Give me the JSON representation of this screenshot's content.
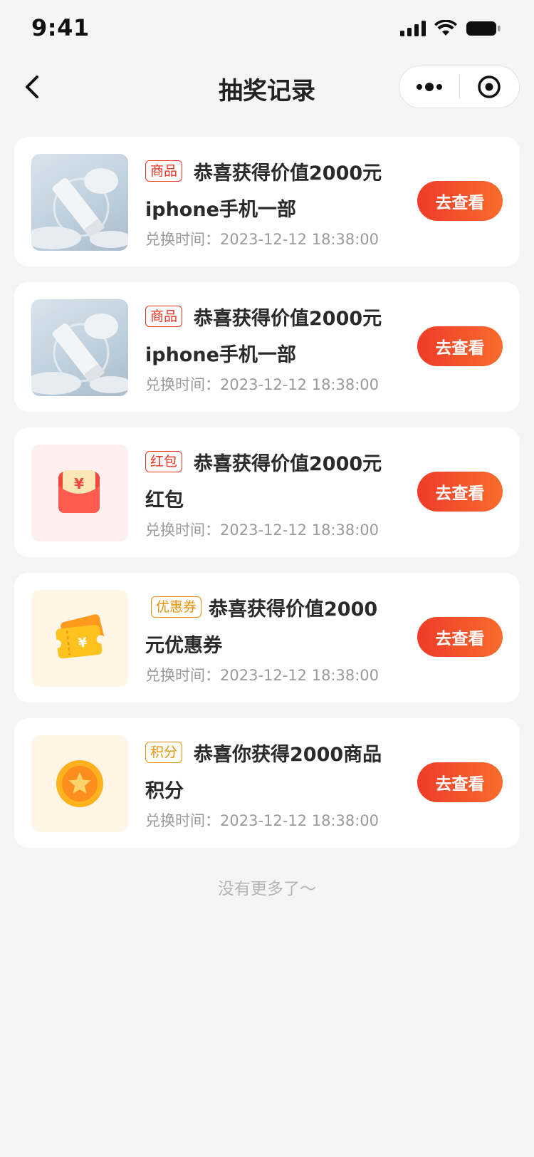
{
  "status_bar": {
    "time": "9:41"
  },
  "nav": {
    "title": "抽奖记录"
  },
  "records": [
    {
      "tag": "商品",
      "tag_color": "#e93323",
      "title_line1": "恭喜获得价值2000元",
      "title_line2": "iphone手机一部",
      "time_label": "兑换时间：",
      "time_value": "2023-12-12 18:38:00",
      "button": "去查看",
      "thumb": "product-image"
    },
    {
      "tag": "商品",
      "tag_color": "#e93323",
      "title_line1": "恭喜获得价值2000元",
      "title_line2": "iphone手机一部",
      "time_label": "兑换时间：",
      "time_value": "2023-12-12 18:38:00",
      "button": "去查看",
      "thumb": "product-image"
    },
    {
      "tag": "红包",
      "tag_color": "#e93323",
      "title_line1": "恭喜获得价值2000元",
      "title_line2": "红包",
      "time_label": "兑换时间：",
      "time_value": "2023-12-12 18:38:00",
      "button": "去查看",
      "thumb": "red-envelope-icon"
    },
    {
      "tag": "优惠券",
      "tag_color": "#e6930a",
      "title_line1": "恭喜获得价值2000",
      "title_line2": "元优惠券",
      "time_label": "兑换时间：",
      "time_value": "2023-12-12 18:38:00",
      "button": "去查看",
      "thumb": "coupon-icon"
    },
    {
      "tag": "积分",
      "tag_color": "#e6930a",
      "title_line1": "恭喜你获得2000商品",
      "title_line2": "积分",
      "time_label": "兑换时间：",
      "time_value": "2023-12-12 18:38:00",
      "button": "去查看",
      "thumb": "points-coin-icon"
    }
  ],
  "footer": {
    "no_more": "没有更多了～"
  },
  "colors": {
    "accent": "#e93323",
    "accent_end": "#f86c2c",
    "points_orange": "#e6930a",
    "background": "#f5f5f5"
  }
}
